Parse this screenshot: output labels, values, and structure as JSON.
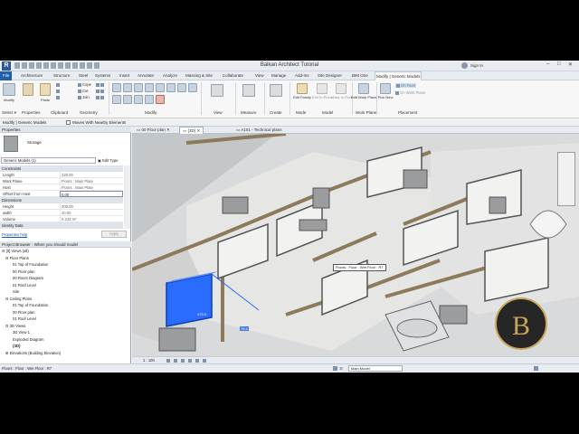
{
  "title": "Balkan Architect Tutorial",
  "signin": "Sign In",
  "ribbon_tabs": [
    "File",
    "Architecture",
    "Structure",
    "Steel",
    "Systems",
    "Insert",
    "Annotate",
    "Analyze",
    "Massing & Site",
    "Collaborate",
    "View",
    "Manage",
    "Add-Ins",
    "Site Designer",
    "BIM One",
    "Modify | Generic Models"
  ],
  "ribbon": {
    "modify_label": "Modify",
    "select_label": "Select ▾",
    "properties_label": "Properties",
    "clipboard_label": "Clipboard",
    "geometry_label": "Geometry",
    "modify_group_label": "Modify",
    "view_label": "View",
    "measure_label": "Measure",
    "create_label": "Create",
    "mode_label": "Mode",
    "model_label": "Model",
    "workplane_label": "Work Plane",
    "placement_label": "Placement",
    "paste_label": "Paste",
    "cope": "Cope",
    "cut": "Cut",
    "join": "Join",
    "edit_family": "Edit Family",
    "edit_in_place": "Edit In-Place",
    "visible_settings": "Visible Settings",
    "mass_in_place": "Mass In-Place",
    "edit_work_plane": "Edit Work Plane",
    "pick_new": "Pick New",
    "on_face": "On Face",
    "on_work_plane": "On Work Plane"
  },
  "optionsbar": {
    "context": "Modify | Generic Models",
    "checkbox_label": "Moves With Nearby Elements"
  },
  "properties": {
    "header": "Properties",
    "type_name": "Storage",
    "selector": "Generic Models (1)",
    "edit_type": "Edit Type",
    "constraints": "Constraints",
    "rows": [
      {
        "k": "Length",
        "v": "228.00"
      },
      {
        "k": "Work Plane",
        "v": "Floors : Main Plate"
      },
      {
        "k": "Host",
        "v": "Floors : Main Plate"
      },
      {
        "k": "Offset from Host",
        "v": "0.00"
      }
    ],
    "dimensions": "Dimensions",
    "dim_rows": [
      {
        "k": "Height",
        "v": "200.00"
      },
      {
        "k": "width",
        "v": "40.00"
      },
      {
        "k": "Volume",
        "v": "0.243 m³"
      }
    ],
    "identity": "Identity Data",
    "help": "Properties help",
    "apply": "Apply"
  },
  "project_browser": {
    "header": "Project Browser - When you should model",
    "items": [
      {
        "t": "⊟ [0] Views (all)",
        "l": 2
      },
      {
        "t": "⊟ Floor Plans",
        "l": 6
      },
      {
        "t": "01 Top of Foundation",
        "l": 14
      },
      {
        "t": "00 Floor plan",
        "l": 14
      },
      {
        "t": "00 Room Diagram",
        "l": 14
      },
      {
        "t": "01 Roof Level",
        "l": 14
      },
      {
        "t": "Site",
        "l": 14
      },
      {
        "t": "⊟ Ceiling Plans",
        "l": 6
      },
      {
        "t": "01 Top of Foundation",
        "l": 14
      },
      {
        "t": "00 Floor plan",
        "l": 14
      },
      {
        "t": "01 Roof Level",
        "l": 14
      },
      {
        "t": "⊟ 3D Views",
        "l": 6
      },
      {
        "t": "3D View 1",
        "l": 14
      },
      {
        "t": "Exploded Diagram",
        "l": 14
      },
      {
        "t": "{3D}",
        "l": 14
      },
      {
        "t": "⊞ Elevations (Building Elevation)",
        "l": 6
      }
    ]
  },
  "view_tabs": [
    "00 Floor plan",
    "{3D}",
    "A101 - Technical plans"
  ],
  "viewport": {
    "tooltip": "Floors : Floor : Wet Floor : R7",
    "dim_a": "475.0",
    "dim_b": "76.4"
  },
  "viewbar": {
    "scale": "1 : 100"
  },
  "status": {
    "text": "Floors : Floor : Wet Floor : R7",
    "workset": "Main Model",
    "zero": ":0"
  },
  "colors": {
    "selection": "#2a6cff",
    "brand_gold": "#c9a55a"
  }
}
